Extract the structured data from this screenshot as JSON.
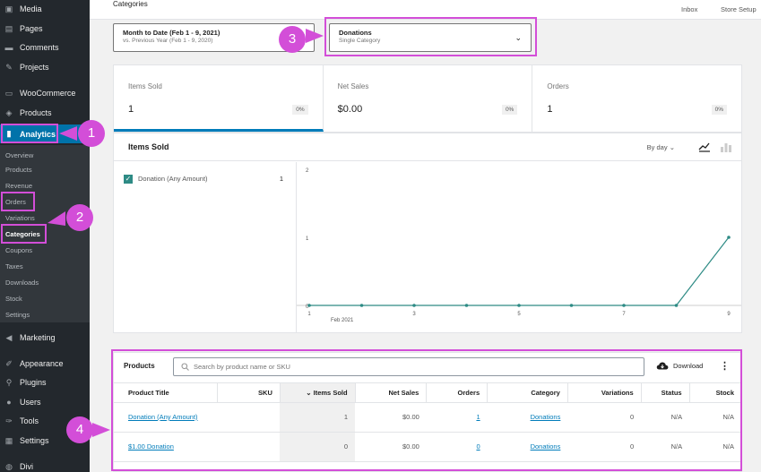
{
  "sidebar": {
    "menu": [
      {
        "label": "Media",
        "icon": "media-icon",
        "glyph": "▣"
      },
      {
        "label": "Pages",
        "icon": "pages-icon",
        "glyph": "▤"
      },
      {
        "label": "Comments",
        "icon": "comments-icon",
        "glyph": "▬"
      },
      {
        "label": "Projects",
        "icon": "pin-icon",
        "glyph": "✎"
      },
      {
        "label": "WooCommerce",
        "icon": "woocommerce-icon",
        "glyph": "▭"
      },
      {
        "label": "Products",
        "icon": "products-icon",
        "glyph": "◈"
      },
      {
        "label": "Analytics",
        "icon": "analytics-icon",
        "glyph": "▮"
      },
      {
        "label": "Marketing",
        "icon": "marketing-icon",
        "glyph": "◀"
      },
      {
        "label": "Appearance",
        "icon": "appearance-icon",
        "glyph": "✐"
      },
      {
        "label": "Plugins",
        "icon": "plugins-icon",
        "glyph": "⚲"
      },
      {
        "label": "Users",
        "icon": "users-icon",
        "glyph": "●"
      },
      {
        "label": "Tools",
        "icon": "tools-icon",
        "glyph": "✑"
      },
      {
        "label": "Settings",
        "icon": "settings-icon",
        "glyph": "▦"
      },
      {
        "label": "Divi",
        "icon": "divi-icon",
        "glyph": "◍"
      }
    ],
    "submenu": [
      "Overview",
      "Products",
      "Revenue",
      "Orders",
      "Variations",
      "Categories",
      "Coupons",
      "Taxes",
      "Downloads",
      "Stock",
      "Settings"
    ]
  },
  "topbar": {
    "breadcrumb": "Categories",
    "inbox": "Inbox",
    "store_setup": "Store Setup"
  },
  "filters": {
    "date_title": "Month to Date (Feb 1 - 9, 2021)",
    "date_compare": "vs. Previous Year (Feb 1 - 9, 2020)",
    "category_title": "Donations",
    "category_sub": "Single Category"
  },
  "summary": [
    {
      "label": "Items Sold",
      "value": "1",
      "delta": "0%"
    },
    {
      "label": "Net Sales",
      "value": "$0.00",
      "delta": "0%"
    },
    {
      "label": "Orders",
      "value": "1",
      "delta": "0%"
    }
  ],
  "chart": {
    "title": "Items Sold",
    "interval": "By day",
    "legend_label": "Donation (Any Amount)",
    "legend_count": "1",
    "x_date_label": "Feb 2021"
  },
  "chart_data": {
    "type": "line",
    "x": [
      1,
      2,
      3,
      4,
      5,
      6,
      7,
      8,
      9
    ],
    "series": [
      {
        "name": "Donation (Any Amount)",
        "values": [
          0,
          0,
          0,
          0,
          0,
          0,
          0,
          0,
          1
        ]
      }
    ],
    "x_ticks": [
      "1",
      "3",
      "5",
      "7",
      "9"
    ],
    "y_ticks": [
      "0",
      "1",
      "2"
    ],
    "ylim": [
      0,
      2
    ],
    "color": "#2e8b85"
  },
  "products": {
    "title": "Products",
    "search_placeholder": "Search by product name or SKU",
    "download": "Download",
    "more": "⋮",
    "columns": [
      "Product Title",
      "SKU",
      "Items Sold",
      "Net Sales",
      "Orders",
      "Category",
      "Variations",
      "Status",
      "Stock"
    ],
    "rows": [
      {
        "title": "Donation (Any Amount)",
        "sku": "",
        "items": "1",
        "net": "$0.00",
        "orders": "1",
        "category": "Donations",
        "variations": "0",
        "status": "N/A",
        "stock": "N/A"
      },
      {
        "title": "$1.00 Donation",
        "sku": "",
        "items": "0",
        "net": "$0.00",
        "orders": "0",
        "category": "Donations",
        "variations": "0",
        "status": "N/A",
        "stock": "N/A"
      }
    ]
  },
  "annotations": {
    "b1": "1",
    "b2": "2",
    "b3": "3",
    "b4": "4",
    "color": "#d34ed8"
  },
  "icons": {
    "sort": "⌄",
    "chevron": "⌄",
    "search": "🔍",
    "check": "✓"
  }
}
